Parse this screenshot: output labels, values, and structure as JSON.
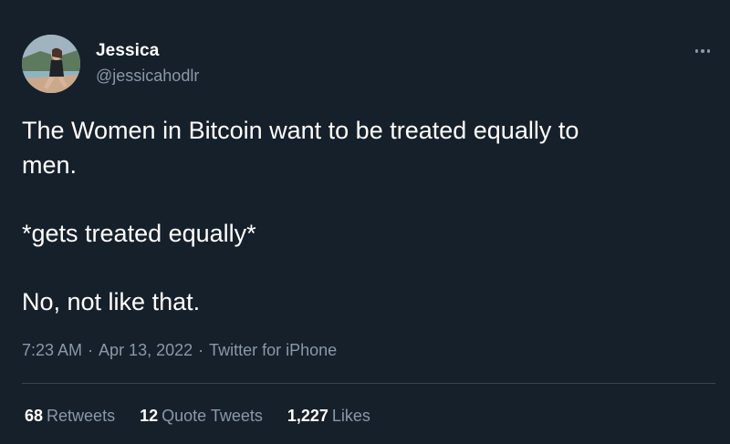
{
  "author": {
    "display_name": "Jessica",
    "handle": "@jessicahodlr",
    "avatar_icon": "profile-photo"
  },
  "more_icon": "more-horizontal-icon",
  "tweet": {
    "lines": [
      "The Women in Bitcoin want to be treated equally to",
      "men.",
      "*gets treated equally*",
      "No, not like that."
    ]
  },
  "meta": {
    "time": "7:23 AM",
    "separator": "·",
    "date": "Apr 13, 2022",
    "source": "Twitter for iPhone"
  },
  "stats": {
    "retweets": {
      "count": "68",
      "label": "Retweets"
    },
    "quote_tweets": {
      "count": "12",
      "label": "Quote Tweets"
    },
    "likes": {
      "count": "1,227",
      "label": "Likes"
    }
  },
  "colors": {
    "background": "#15202b",
    "text": "#ffffff",
    "secondary": "#8b98a5",
    "divider": "#38444d"
  }
}
